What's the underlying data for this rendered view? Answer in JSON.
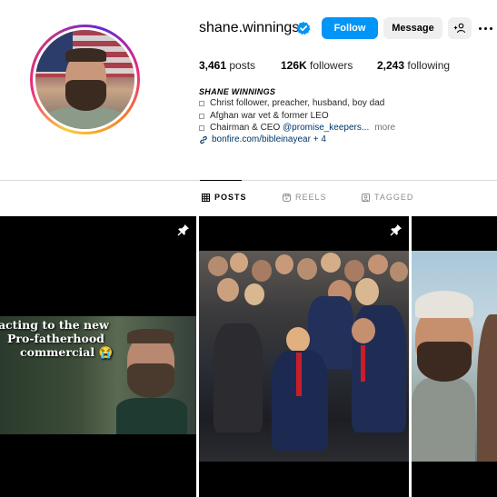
{
  "profile": {
    "username": "shane.winnings",
    "verified": true,
    "buttons": {
      "follow": "Follow",
      "message": "Message",
      "add_user_icon": "add-user-icon"
    },
    "stats": {
      "posts_value": "3,461",
      "posts_label": "posts",
      "followers_value": "126K",
      "followers_label": "followers",
      "following_value": "2,243",
      "following_label": "following"
    },
    "full_name": "SHANE WINNINGS",
    "bio": {
      "line1": "Christ follower, preacher, husband, boy dad",
      "line2": "Afghan war vet & former LEO",
      "line3_prefix": "Chairman & CEO ",
      "line3_mention": "@promise_keepers...",
      "line3_more": "more"
    },
    "link": {
      "text": "bonfire.com/bibleinayear + 4",
      "icon": "link-icon"
    }
  },
  "tabs": [
    {
      "label": "POSTS",
      "icon": "grid-icon",
      "active": true
    },
    {
      "label": "REELS",
      "icon": "reels-icon",
      "active": false
    },
    {
      "label": "TAGGED",
      "icon": "tagged-icon",
      "active": false
    }
  ],
  "posts": {
    "post1": {
      "caption_line1": "eacting to the new",
      "caption_line2": "Pro-fatherhood",
      "caption_line3": "commercial 😭",
      "pinned": true
    },
    "post2": {
      "pinned": true
    },
    "post3": {
      "pinned": false
    }
  },
  "colors": {
    "accent": "#0095f6",
    "link": "#00376b",
    "muted": "#737373"
  }
}
